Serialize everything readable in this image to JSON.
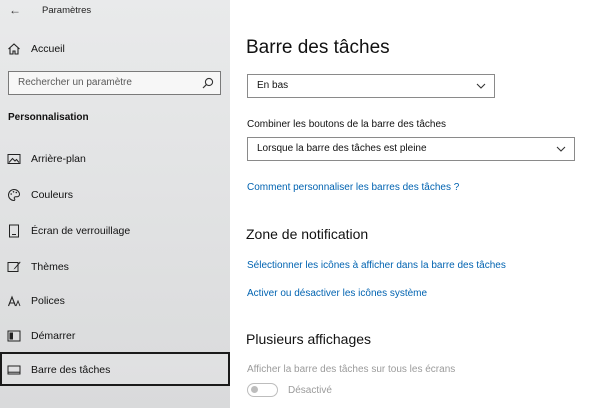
{
  "window": {
    "title": "Paramètres"
  },
  "sidebar": {
    "home_label": "Accueil",
    "search_placeholder": "Rechercher un paramètre",
    "section_title": "Personnalisation",
    "items": [
      {
        "label": "Arrière-plan",
        "icon": "image-icon"
      },
      {
        "label": "Couleurs",
        "icon": "palette-icon"
      },
      {
        "label": "Écran de verrouillage",
        "icon": "lock-screen-icon"
      },
      {
        "label": "Thèmes",
        "icon": "brush-icon"
      },
      {
        "label": "Polices",
        "icon": "font-icon"
      },
      {
        "label": "Démarrer",
        "icon": "start-icon"
      },
      {
        "label": "Barre des tâches",
        "icon": "taskbar-icon",
        "selected": true
      }
    ]
  },
  "main": {
    "title": "Barre des tâches",
    "position_select": {
      "value": "En bas"
    },
    "combine": {
      "label": "Combiner les boutons de la barre des tâches",
      "value": "Lorsque la barre des tâches est pleine"
    },
    "customize_link": "Comment personnaliser les barres des tâches ?",
    "notification": {
      "title": "Zone de notification",
      "link_icons": "Sélectionner les icônes à afficher dans la barre des tâches",
      "link_system": "Activer ou désactiver les icônes système"
    },
    "multi_display": {
      "title": "Plusieurs affichages",
      "show_all_label": "Afficher la barre des tâches sur tous les écrans",
      "toggle_state": "Désactivé"
    }
  },
  "colors": {
    "link": "#0063b1",
    "disabled": "#9b9b9b"
  }
}
